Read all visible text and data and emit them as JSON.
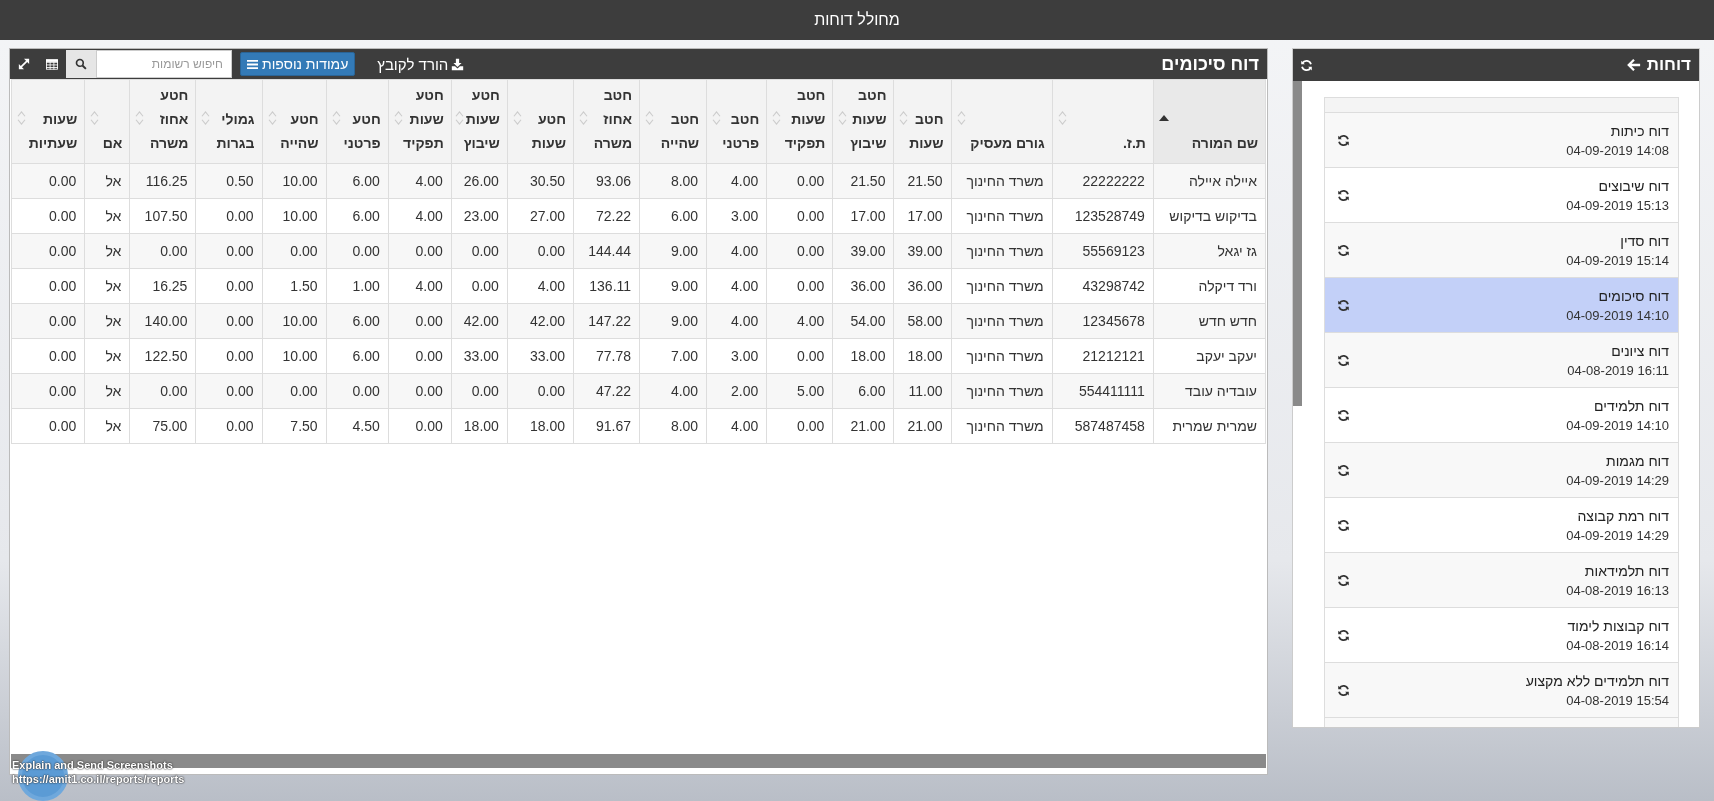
{
  "window": {
    "title": "מחולל דוחות"
  },
  "report": {
    "title": "דוח סיכומים",
    "download_label": "הורד לקובץ",
    "columns_button": "עמודות נוספות",
    "search": {
      "placeholder": "חיפוש רשומות"
    },
    "table": {
      "columns": [
        {
          "label": "שם המורה",
          "sorted": true
        },
        {
          "label": "ת.ז.",
          "sorted": false
        },
        {
          "label": "גורם מעסיק",
          "sorted": false
        },
        {
          "label": "חטב\nשעות",
          "sorted": false
        },
        {
          "label": "חטב\nשעות\nשיבוץ",
          "sorted": false
        },
        {
          "label": "חטב\nשעות\nתפקיד",
          "sorted": false
        },
        {
          "label": "חטב\nפרטני",
          "sorted": false
        },
        {
          "label": "חטב\nשהייה",
          "sorted": false
        },
        {
          "label": "חטב\nאחוז\nמשרה",
          "sorted": false
        },
        {
          "label": "חטע\nשעות",
          "sorted": false
        },
        {
          "label": "חטע\nשעות\nשיבוץ",
          "sorted": false
        },
        {
          "label": "חטע\nשעות\nתפקיד",
          "sorted": false
        },
        {
          "label": "חטע\nפרטני",
          "sorted": false
        },
        {
          "label": "חטע\nשהייה",
          "sorted": false
        },
        {
          "label": "גמולי\nבגרות",
          "sorted": false
        },
        {
          "label": "חטע\nאחוז\nמשרה",
          "sorted": false
        },
        {
          "label": "אם",
          "sorted": false
        },
        {
          "label": "שעות\nשעתיות",
          "sorted": false
        }
      ],
      "rows": [
        [
          "איילה איילה",
          "22222222",
          "משרד החינוך",
          "21.50",
          "21.50",
          "0.00",
          "4.00",
          "8.00",
          "93.06",
          "30.50",
          "26.00",
          "4.00",
          "6.00",
          "10.00",
          "0.50",
          "116.25",
          "אל",
          "0.00"
        ],
        [
          "בדיקוש בדיקוש",
          "123528749",
          "משרד החינוך",
          "17.00",
          "17.00",
          "0.00",
          "3.00",
          "6.00",
          "72.22",
          "27.00",
          "23.00",
          "4.00",
          "6.00",
          "10.00",
          "0.00",
          "107.50",
          "אל",
          "0.00"
        ],
        [
          "גז יגאל",
          "55569123",
          "משרד החינוך",
          "39.00",
          "39.00",
          "0.00",
          "4.00",
          "9.00",
          "144.44",
          "0.00",
          "0.00",
          "0.00",
          "0.00",
          "0.00",
          "0.00",
          "0.00",
          "אל",
          "0.00"
        ],
        [
          "ורד דיקלה",
          "43298742",
          "משרד החינוך",
          "36.00",
          "36.00",
          "0.00",
          "4.00",
          "9.00",
          "136.11",
          "4.00",
          "0.00",
          "4.00",
          "1.00",
          "1.50",
          "0.00",
          "16.25",
          "אל",
          "0.00"
        ],
        [
          "חדש חדש",
          "12345678",
          "משרד החינוך",
          "58.00",
          "54.00",
          "4.00",
          "4.00",
          "9.00",
          "147.22",
          "42.00",
          "42.00",
          "0.00",
          "6.00",
          "10.00",
          "0.00",
          "140.00",
          "אל",
          "0.00"
        ],
        [
          "יעקב יעקב",
          "21212121",
          "משרד החינוך",
          "18.00",
          "18.00",
          "0.00",
          "3.00",
          "7.00",
          "77.78",
          "33.00",
          "33.00",
          "0.00",
          "6.00",
          "10.00",
          "0.00",
          "122.50",
          "אל",
          "0.00"
        ],
        [
          "עובדיה עובד",
          "554411111",
          "משרד החינוך",
          "11.00",
          "6.00",
          "5.00",
          "2.00",
          "4.00",
          "47.22",
          "0.00",
          "0.00",
          "0.00",
          "0.00",
          "0.00",
          "0.00",
          "0.00",
          "אל",
          "0.00"
        ],
        [
          "שמרית שמרית",
          "587487458",
          "משרד החינוך",
          "21.00",
          "21.00",
          "0.00",
          "4.00",
          "8.00",
          "91.67",
          "18.00",
          "18.00",
          "0.00",
          "4.50",
          "7.50",
          "0.00",
          "75.00",
          "אל",
          "0.00"
        ]
      ]
    }
  },
  "sidebar": {
    "title": "דוחות",
    "items": [
      {
        "title": "דוח כיתות",
        "date": "14:08 04-09-2019",
        "selected": false
      },
      {
        "title": "דוח שיבוצים",
        "date": "15:13 04-09-2019",
        "selected": false
      },
      {
        "title": "דוח סדין",
        "date": "15:14 04-09-2019",
        "selected": false
      },
      {
        "title": "דוח סיכומים",
        "date": "14:10 04-09-2019",
        "selected": true
      },
      {
        "title": "דוח ציונים",
        "date": "16:11 04-08-2019",
        "selected": false
      },
      {
        "title": "דוח תלמידים",
        "date": "14:10 04-09-2019",
        "selected": false
      },
      {
        "title": "דוח מגמות",
        "date": "14:29 04-09-2019",
        "selected": false
      },
      {
        "title": "דוח רמת קבוצה",
        "date": "14:29 04-09-2019",
        "selected": false
      },
      {
        "title": "דוח תלמידאות",
        "date": "16:13 04-08-2019",
        "selected": false
      },
      {
        "title": "דוח קבוצות לימוד",
        "date": "16:14 04-08-2019",
        "selected": false
      },
      {
        "title": "דוח תלמידים ללא מקצוע",
        "date": "15:54 04-08-2019",
        "selected": false
      }
    ]
  },
  "overlay": {
    "caption": "Explain and Send Screenshots",
    "url": "https://amit1.co.il/reports/reports"
  }
}
